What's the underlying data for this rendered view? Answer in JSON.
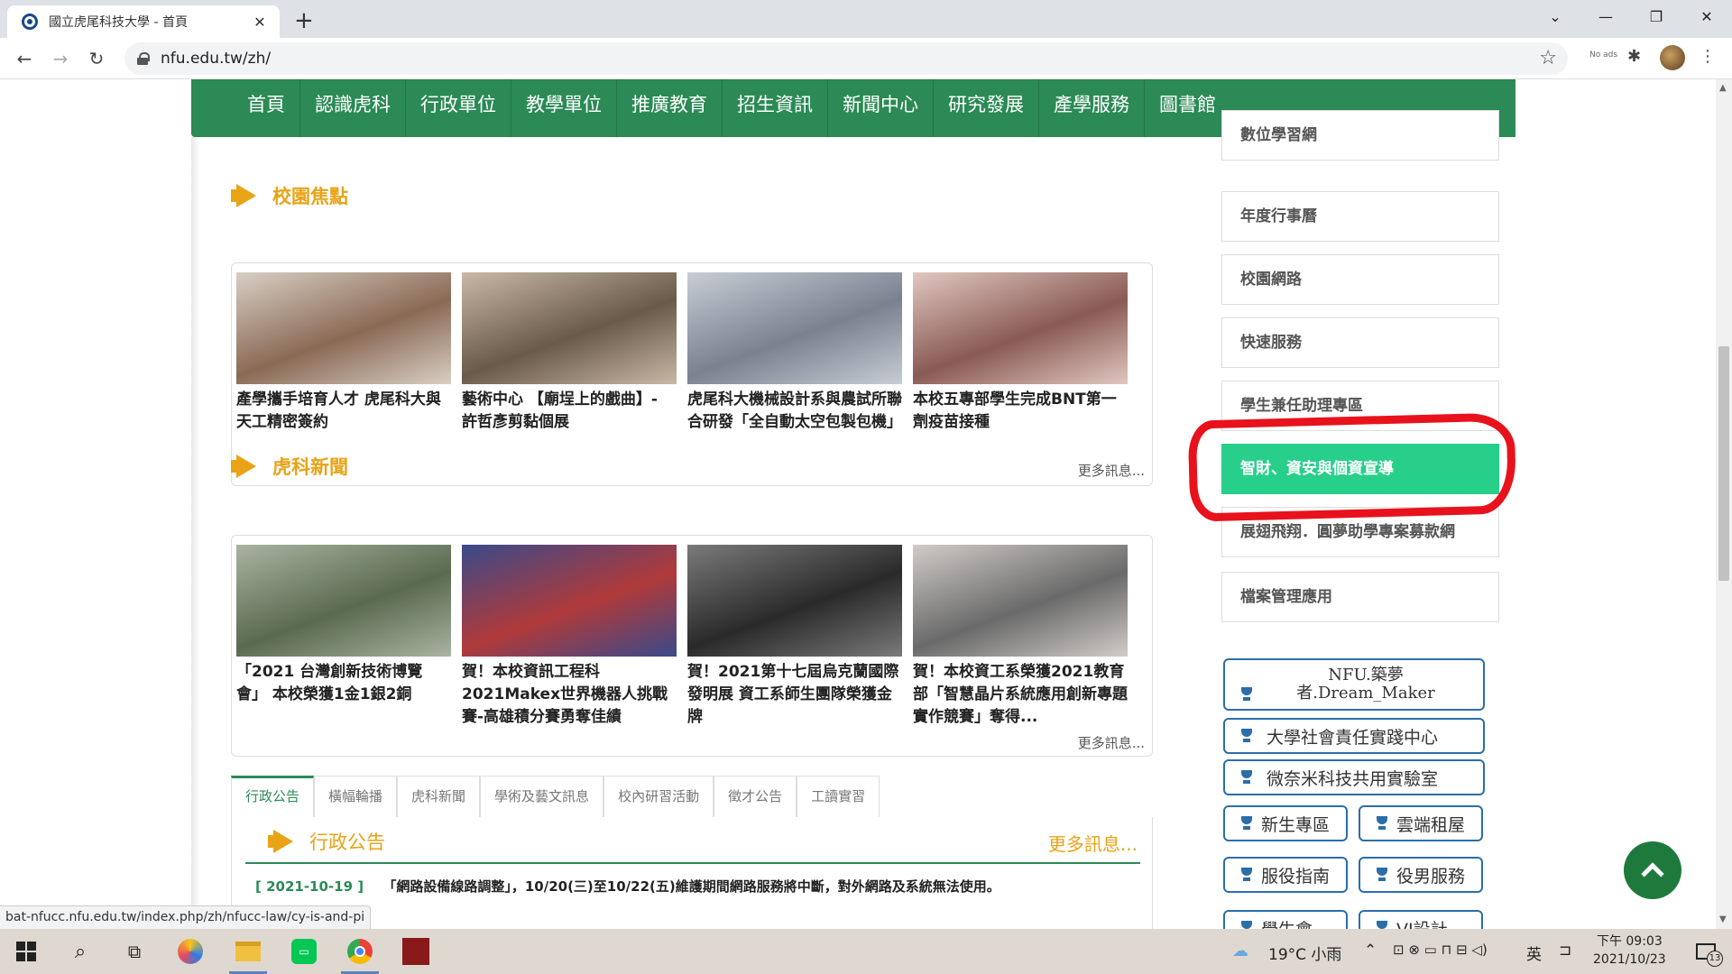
{
  "browser": {
    "tab_title": "國立虎尾科技大學 - 首頁",
    "new_tab": "+",
    "url": "nfu.edu.tw/zh/",
    "status_url": "bat-nfucc.nfu.edu.tw/index.php/zh/nfucc-law/cy-is-and-pi",
    "ext_label": "No ads"
  },
  "main_nav": {
    "items": [
      "首頁",
      "認識虎科",
      "行政單位",
      "教學單位",
      "推廣教育",
      "招生資訊",
      "新聞中心",
      "研究發展",
      "產學服務",
      "圖書館"
    ]
  },
  "campus_focus": {
    "title": "校園焦點",
    "more": "更多訊息...",
    "items": [
      {
        "text": "產學攜手培育人才 虎尾科大與天工精密簽約",
        "colors": [
          "#8a6a55",
          "#d8cfc4"
        ]
      },
      {
        "text": "藝術中心 【廟埕上的戲曲】- 許哲彥剪黏個展",
        "colors": [
          "#6a5a4a",
          "#c9b8a6"
        ]
      },
      {
        "text": "虎尾科大機械設計系與農試所聯合研發「全自動太空包製包機」",
        "colors": [
          "#7a8290",
          "#c8cdd4"
        ]
      },
      {
        "text": "本校五專部學生完成BNT第一劑疫苗接種",
        "colors": [
          "#8a5a55",
          "#e0c8c0"
        ]
      }
    ]
  },
  "nfu_news": {
    "title": "虎科新聞",
    "more": "更多訊息...",
    "items": [
      {
        "text": "「2021 台灣創新技術博覽會」 本校榮獲1金1銀2銅",
        "colors": [
          "#5a6a50",
          "#a8b4a0"
        ]
      },
      {
        "text": "賀！本校資訊工程科2021Makex世界機器人挑戰賽-高雄積分賽勇奪佳績",
        "colors": [
          "#b03a3a",
          "#3a4a8a"
        ]
      },
      {
        "text": "賀！2021第十七屆烏克蘭國際發明展 資工系師生團隊榮獲金牌",
        "colors": [
          "#2a2a2a",
          "#7a7a7a"
        ]
      },
      {
        "text": "賀！本校資工系榮獲2021教育部「智慧晶片系統應用創新專題實作競賽」奪得...",
        "colors": [
          "#6a6a6a",
          "#d0ccc8"
        ]
      }
    ]
  },
  "tabs": [
    "行政公告",
    "橫幅輪播",
    "虎科新聞",
    "學術及藝文訊息",
    "校內研習活動",
    "徵才公告",
    "工讀實習"
  ],
  "announcement": {
    "title": "行政公告",
    "more": "更多訊息...",
    "date": "[ 2021-10-19 ]",
    "text": "「網路設備線路調整」，10/20(三)至10/22(五)維護期間網路服務將中斷，對外網路及系統無法使用。"
  },
  "sidebar": {
    "buttons": [
      "數位學習網",
      "年度行事曆",
      "校園網路",
      "快速服務",
      "學生兼任助理專區",
      "智財、資安與個資宣導",
      "展翅飛翔．圓夢助學專案募款網",
      "檔案管理應用"
    ],
    "pills": [
      "NFU.築夢者.Dream_Maker",
      "大學社會責任實踐中心",
      "微奈米科技共用實驗室",
      "新生專區",
      "雲端租屋",
      "服役指南",
      "役男服務",
      "學生會",
      "VI設計"
    ]
  },
  "taskbar": {
    "weather": "19°C 小雨",
    "ime": "英",
    "time": "下午 09:03",
    "date": "2021/10/23",
    "notifications": "13"
  },
  "colors": {
    "nav_green": "#2b8a55",
    "highlight_green": "#28cf8b",
    "accent_orange": "#e8a317",
    "annotation_red": "#e8121c"
  }
}
